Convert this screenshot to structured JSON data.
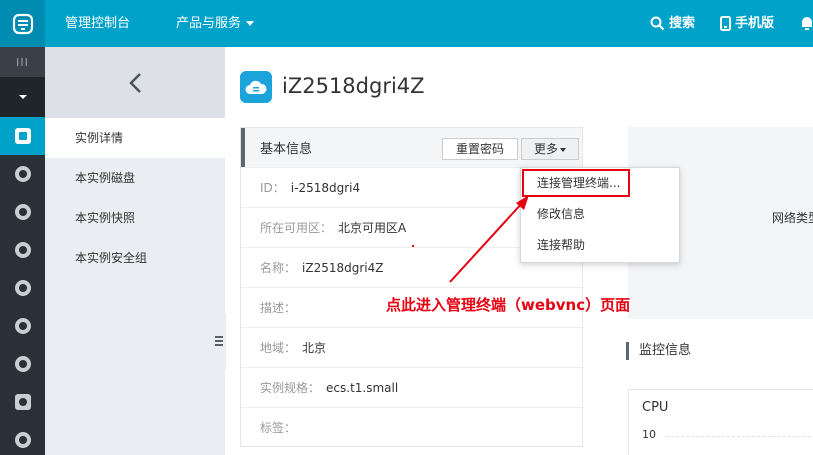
{
  "topbar": {
    "console_label": "管理控制台",
    "products_label": "产品与服务",
    "search_label": "搜索",
    "mobile_label": "手机版"
  },
  "subnav": {
    "items": [
      {
        "label": "实例详情"
      },
      {
        "label": "本实例磁盘"
      },
      {
        "label": "本实例快照"
      },
      {
        "label": "本实例安全组"
      }
    ]
  },
  "header": {
    "title": "iZ2518dgri4Z"
  },
  "basic_info": {
    "title": "基本信息",
    "reset_password_label": "重置密码",
    "more_label": "更多",
    "rows": [
      {
        "label": "ID：",
        "value": "i-2518dgri4"
      },
      {
        "label": "所在可用区：",
        "value": "北京可用区A"
      },
      {
        "label": "名称：",
        "value": "iZ2518dgri4Z"
      },
      {
        "label": "描述：",
        "value": ""
      },
      {
        "label": "地域：",
        "value": "北京"
      },
      {
        "label": "实例规格：",
        "value": "ecs.t1.small"
      },
      {
        "label": "标签：",
        "value": ""
      }
    ]
  },
  "more_menu": {
    "items": [
      {
        "label": "连接管理终端..."
      },
      {
        "label": "修改信息"
      },
      {
        "label": "连接帮助"
      }
    ]
  },
  "annotation": {
    "text": "点此进入管理终端（webvnc）页面",
    "color": "#e60012"
  },
  "network": {
    "label": "网络类型"
  },
  "monitor": {
    "title": "监控信息",
    "cpu_label": "CPU",
    "cpu_tick": "10"
  },
  "colors": {
    "accent": "#00a2ca",
    "sidebar_dark": "#293038",
    "highlight": "#e60012"
  }
}
